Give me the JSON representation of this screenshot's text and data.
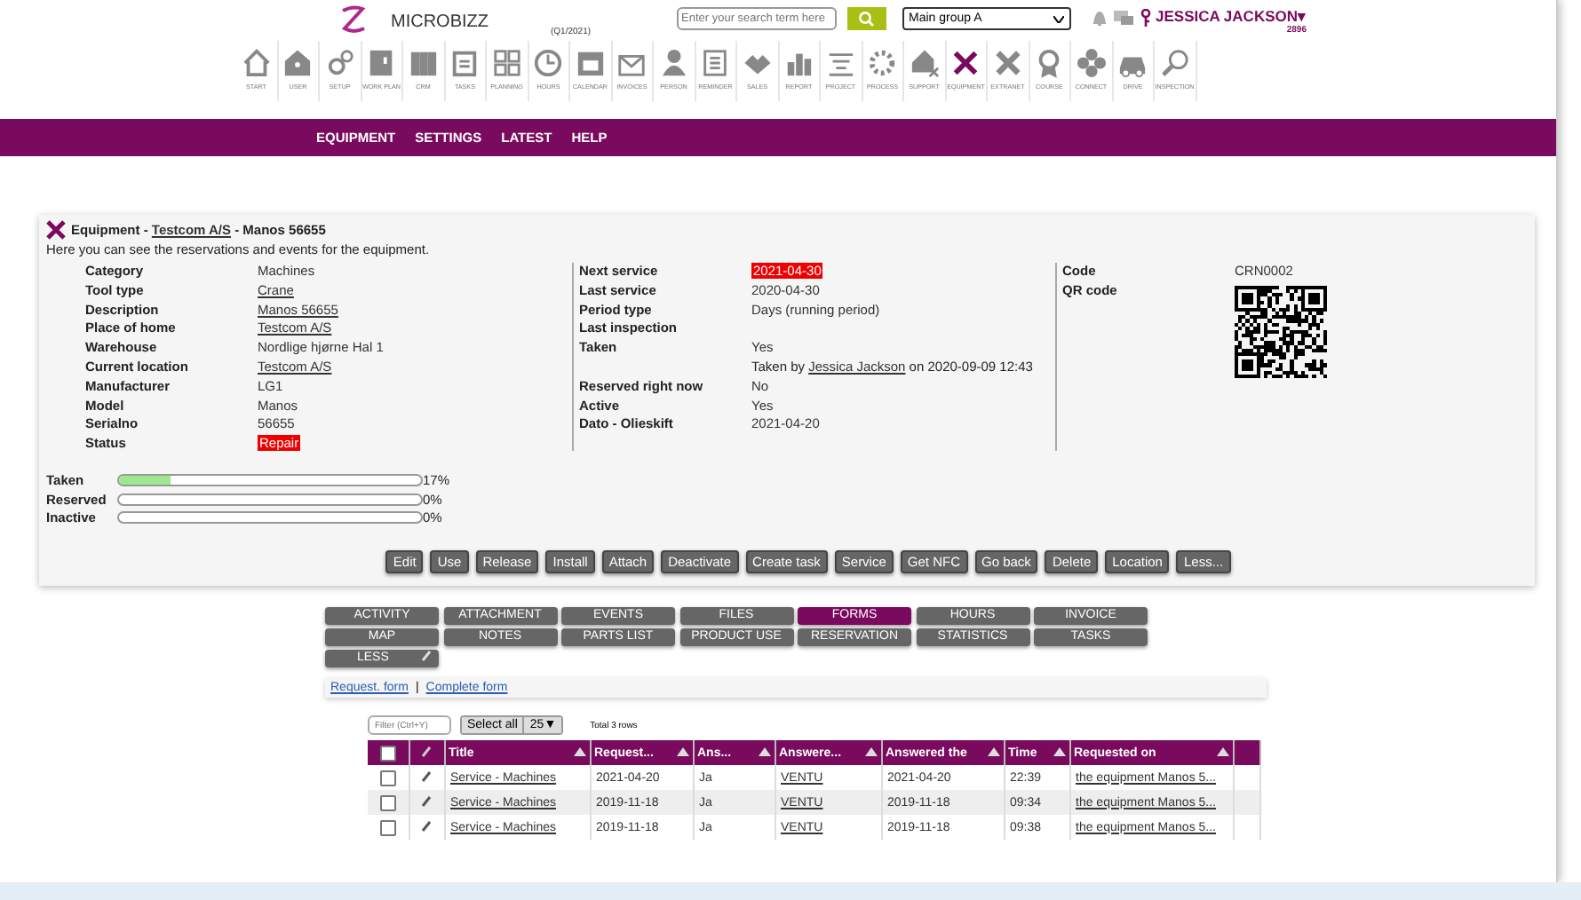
{
  "header": {
    "brand": "MICROBIZZ",
    "period": "(Q1/2021)",
    "search": {
      "placeholder": "Enter your search term here"
    },
    "group_select": "Main group A",
    "user": "JESSICA JACKSON▾",
    "user_number": "2896"
  },
  "toolbar": [
    {
      "label": "START",
      "selected": false
    },
    {
      "label": "USER",
      "selected": false
    },
    {
      "label": "SETUP",
      "selected": false
    },
    {
      "label": "WORK PLAN",
      "selected": false
    },
    {
      "label": "CRM",
      "selected": false
    },
    {
      "label": "TASKS",
      "selected": false
    },
    {
      "label": "PLANNING",
      "selected": false
    },
    {
      "label": "HOURS",
      "selected": false
    },
    {
      "label": "CALENDAR",
      "selected": false
    },
    {
      "label": "INVOICES",
      "selected": false
    },
    {
      "label": "PERSON",
      "selected": false
    },
    {
      "label": "REMINDER",
      "selected": false
    },
    {
      "label": "SALES",
      "selected": false
    },
    {
      "label": "REPORT",
      "selected": false
    },
    {
      "label": "PROJECT",
      "selected": false
    },
    {
      "label": "PROCESS",
      "selected": false
    },
    {
      "label": "SUPPORT",
      "selected": false
    },
    {
      "label": "EQUIPMENT",
      "selected": true
    },
    {
      "label": "EXTRANET",
      "selected": false
    },
    {
      "label": "COURSE",
      "selected": false
    },
    {
      "label": "CONNECT",
      "selected": false
    },
    {
      "label": "DRIVE",
      "selected": false
    },
    {
      "label": "INSPECTION",
      "selected": false
    }
  ],
  "menu": [
    "EQUIPMENT",
    "SETTINGS",
    "LATEST",
    "HELP"
  ],
  "card": {
    "title_prefix": "Equipment - ",
    "title_link": "Testcom A/S",
    "title_suffix": " - Manos 56655",
    "subtitle": "Here you can see the reservations and events for the equipment.",
    "left": [
      {
        "label": "Category",
        "value": "Machines",
        "kind": "text"
      },
      {
        "label": "Tool type",
        "value": "Crane",
        "kind": "link"
      },
      {
        "label": "Description",
        "value": "Manos 56655",
        "kind": "link"
      },
      {
        "label": "Place of home",
        "value": "Testcom A/S",
        "kind": "link"
      },
      {
        "label": "Warehouse",
        "value": "Nordlige hjørne Hal 1",
        "kind": "text"
      },
      {
        "label": "Current location",
        "value": "Testcom A/S",
        "kind": "link"
      },
      {
        "label": "Manufacturer",
        "value": "LG1",
        "kind": "text"
      },
      {
        "label": "Model",
        "value": "Manos",
        "kind": "text"
      },
      {
        "label": "Serialno",
        "value": "56655",
        "kind": "text"
      },
      {
        "label": "Status",
        "value": "Repair",
        "kind": "alert"
      }
    ],
    "middle": [
      {
        "label": "Next service",
        "value": "2021-04-30",
        "kind": "alert"
      },
      {
        "label": "Last service",
        "value": "2020-04-30",
        "kind": "text"
      },
      {
        "label": "Period type",
        "value": "Days (running period)",
        "kind": "text"
      },
      {
        "label": "Last inspection",
        "kind": "text"
      },
      {
        "label": "Taken",
        "value": "Yes",
        "kind": "text"
      },
      {
        "kind": "note",
        "note_prefix": "Taken by ",
        "note_link": "Jessica Jackson",
        "note_suffix": " on 2020-09-09 12:43"
      },
      {
        "label": "Reserved right now",
        "value": "No",
        "kind": "text"
      },
      {
        "label": "Active",
        "value": "Yes",
        "kind": "text"
      },
      {
        "label": "Dato - Olieskift",
        "value": "2021-04-20",
        "kind": "text"
      }
    ],
    "right": [
      {
        "label": "Code",
        "value": "CRN0002",
        "kind": "text"
      },
      {
        "label": "QR code",
        "kind": "qr"
      }
    ],
    "meters": [
      {
        "label": "Taken",
        "level": 0.17,
        "reading": "17%"
      },
      {
        "label": "Reserved",
        "level": 0,
        "reading": "0%"
      },
      {
        "label": "Inactive",
        "level": 0,
        "reading": "0%"
      }
    ],
    "buttons": [
      "Edit",
      "Use",
      "Release",
      "Install",
      "Attach",
      "Deactivate",
      "Create task",
      "Service",
      "Get NFC",
      "Go back",
      "Delete",
      "Location",
      "Less..."
    ]
  },
  "tabs": [
    {
      "label": "ACTIVITY",
      "selected": false
    },
    {
      "label": "ATTACHMENT",
      "selected": false
    },
    {
      "label": "EVENTS",
      "selected": false
    },
    {
      "label": "FILES",
      "selected": false
    },
    {
      "label": "FORMS",
      "selected": true
    },
    {
      "label": "HOURS",
      "selected": false
    },
    {
      "label": "INVOICE",
      "selected": false
    },
    {
      "label": "MAP",
      "selected": false
    },
    {
      "label": "NOTES",
      "selected": false
    },
    {
      "label": "PARTS LIST",
      "selected": false
    },
    {
      "label": "PRODUCT USE",
      "selected": false
    },
    {
      "label": "RESERVATION",
      "selected": false
    },
    {
      "label": "STATISTICS",
      "selected": false
    },
    {
      "label": "TASKS",
      "selected": false
    },
    {
      "label": "LESS",
      "selected": false,
      "kind": "less"
    }
  ],
  "form_links": [
    "Request. form",
    "Complete form"
  ],
  "form_link_separator": "|",
  "table": {
    "filter_placeholder": "Filter (Ctrl+Y)",
    "select_all": "Select all",
    "page_size": "25▼",
    "total": "Total 3 rows",
    "select_all_checked": false,
    "columns": [
      "Title",
      "Request...",
      "Ans...",
      "Answere...",
      "Answered the",
      "Time",
      "Requested on"
    ],
    "rows": [
      {
        "checked": false,
        "cells": [
          "Service - Machines",
          "2021-04-20",
          "Ja",
          "VENTU",
          "2021-04-20",
          "22:39",
          "the equipment Manos 5..."
        ]
      },
      {
        "checked": false,
        "cells": [
          "Service - Machines",
          "2019-11-18",
          "Ja",
          "VENTU",
          "2019-11-18",
          "09:34",
          "the equipment Manos 5..."
        ]
      },
      {
        "checked": false,
        "cells": [
          "Service - Machines",
          "2019-11-18",
          "Ja",
          "VENTU",
          "2019-11-18",
          "09:38",
          "the equipment Manos 5..."
        ]
      }
    ]
  }
}
